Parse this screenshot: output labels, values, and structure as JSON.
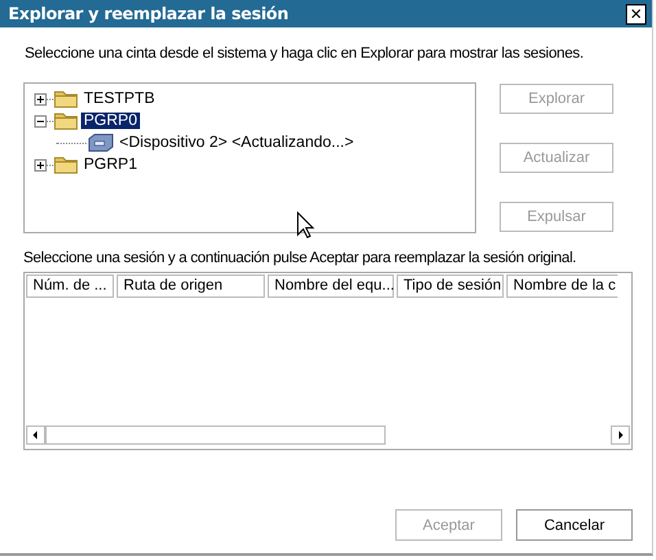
{
  "window": {
    "title": "Explorar y reemplazar la sesión",
    "close": "✕"
  },
  "instruction": "Seleccione una cinta desde el sistema y haga clic en Explorar para mostrar las sesiones.",
  "tree": [
    {
      "label": "TESTPTB",
      "kind": "folder",
      "expanded": false,
      "selected": false
    },
    {
      "label": "PGRP0",
      "kind": "folder",
      "expanded": true,
      "selected": true,
      "children": [
        {
          "label": "<Dispositivo 2> <Actualizando...>",
          "kind": "device",
          "selected": false
        }
      ]
    },
    {
      "label": "PGRP1",
      "kind": "folder",
      "expanded": false,
      "selected": false
    }
  ],
  "side_buttons": [
    {
      "label": "Explorar",
      "disabled": true
    },
    {
      "label": "Actualizar",
      "disabled": true
    },
    {
      "label": "Expulsar",
      "disabled": true
    }
  ],
  "session_instruction": "Seleccione una sesión y a continuación pulse Aceptar para reemplazar la sesión original.",
  "table": {
    "columns": [
      "Núm. de ...",
      "Ruta de origen",
      "Nombre del equ...",
      "Tipo de sesión",
      "Nombre de la c"
    ]
  },
  "buttons": [
    {
      "label": "Aceptar",
      "disabled": true
    },
    {
      "label": "Cancelar",
      "disabled": false
    }
  ]
}
